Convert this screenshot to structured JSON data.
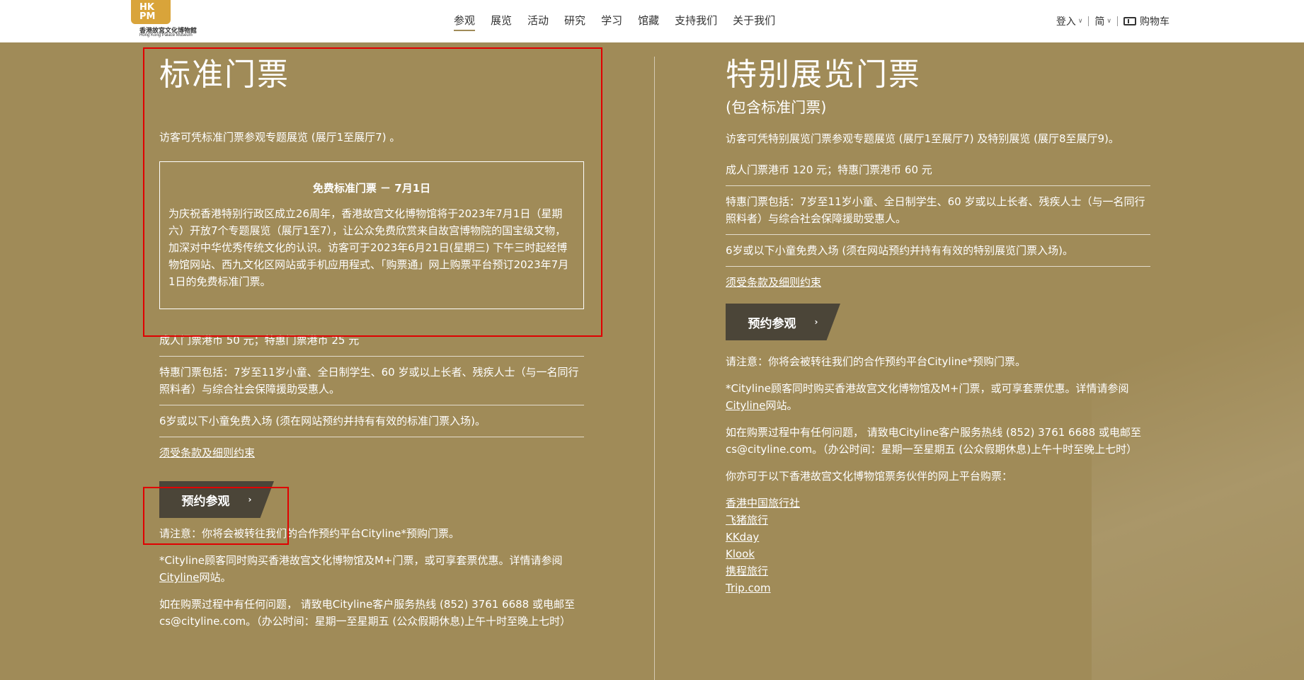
{
  "logo": {
    "mark_top": "HK",
    "mark_bottom": "PM",
    "line1": "香港故宮文化博物館",
    "line2": "Hong Kong Palace Museum"
  },
  "nav": [
    {
      "label": "参观",
      "active": true
    },
    {
      "label": "展览"
    },
    {
      "label": "活动"
    },
    {
      "label": "研究"
    },
    {
      "label": "学习"
    },
    {
      "label": "馆藏"
    },
    {
      "label": "支持我们"
    },
    {
      "label": "关于我们"
    }
  ],
  "header_right": {
    "login": "登入",
    "lang": "简",
    "cart": "购物车"
  },
  "left": {
    "title": "标准门票",
    "intro": "访客可凭标准门票参观专题展览 (展厅1至展厅7) 。",
    "notice": {
      "title": "免费标准门票 － 7月1日",
      "body": "为庆祝香港特别行政区成立26周年，香港故宫文化博物馆将于2023年7月1日（星期六）开放7个专题展览（展厅1至7），让公众免费欣赏来自故宫博物院的国宝级文物，加深对中华优秀传统文化的认识。访客可于2023年6月21日(星期三) 下午三时起经博物馆网站、西九文化区网站或手机应用程式、「购票通」网上购票平台预订2023年7月1日的免费标准门票。"
    },
    "price": "成人门票港币 50 元；特惠门票港币 25 元",
    "concession": "特惠门票包括：7岁至11岁小童、全日制学生、60 岁或以上长者、残疾人士（与一名同行照料者）与综合社会保障援助受惠人。",
    "children": "6岁或以下小童免费入场 (须在网站预约并持有有效的标准门票入场)。",
    "terms": "须受条款及细则约束",
    "button": "预约参观",
    "note1": "请注意：你将会被转往我们的合作预约平台Cityline*预购门票。",
    "note2_a": "*Cityline顾客同时购买香港故宫文化博物馆及M+门票，或可享套票优惠。详情请参阅",
    "note2_link": "Cityline",
    "note2_b": "网站。",
    "note3": "如在购票过程中有任何问题， 请致电Cityline客户服务热线 (852) 3761 6688 或电邮至cs@cityline.com。（办公时间：星期一至星期五 (公众假期休息)上午十时至晚上七时）"
  },
  "right": {
    "title": "特别展览门票",
    "subtitle": "(包含标准门票)",
    "intro": "访客可凭特别展览门票参观专题展览 (展厅1至展厅7) 及特别展览 (展厅8至展厅9)。",
    "price": "成人门票港币 120 元；特惠门票港币 60 元",
    "concession": "特惠门票包括：7岁至11岁小童、全日制学生、60 岁或以上长者、残疾人士（与一名同行照料者）与综合社会保障援助受惠人。",
    "children": "6岁或以下小童免费入场 (须在网站预约并持有有效的特别展览门票入场)。",
    "terms": "须受条款及细则约束",
    "button": "预约参观",
    "note1": "请注意：你将会被转往我们的合作预约平台Cityline*预购门票。",
    "note2_a": "*Cityline顾客同时购买香港故宫文化博物馆及M+门票，或可享套票优惠。详情请参阅",
    "note2_link": "Cityline",
    "note2_b": "网站。",
    "note3": "如在购票过程中有任何问题， 请致电Cityline客户服务热线 (852) 3761 6688 或电邮至cs@cityline.com。（办公时间：星期一至星期五 (公众假期休息)上午十时至晚上七时）",
    "partners_intro": "你亦可于以下香港故宫文化博物馆票务伙伴的网上平台购票：",
    "partners": [
      "香港中国旅行社",
      "飞猪旅行",
      "KKday",
      "Klook",
      "携程旅行",
      "Trip.com"
    ]
  },
  "colors": {
    "background": "#a08b58",
    "button": "#4b4538",
    "highlight": "#e00000",
    "logo": "#d9a43a"
  }
}
